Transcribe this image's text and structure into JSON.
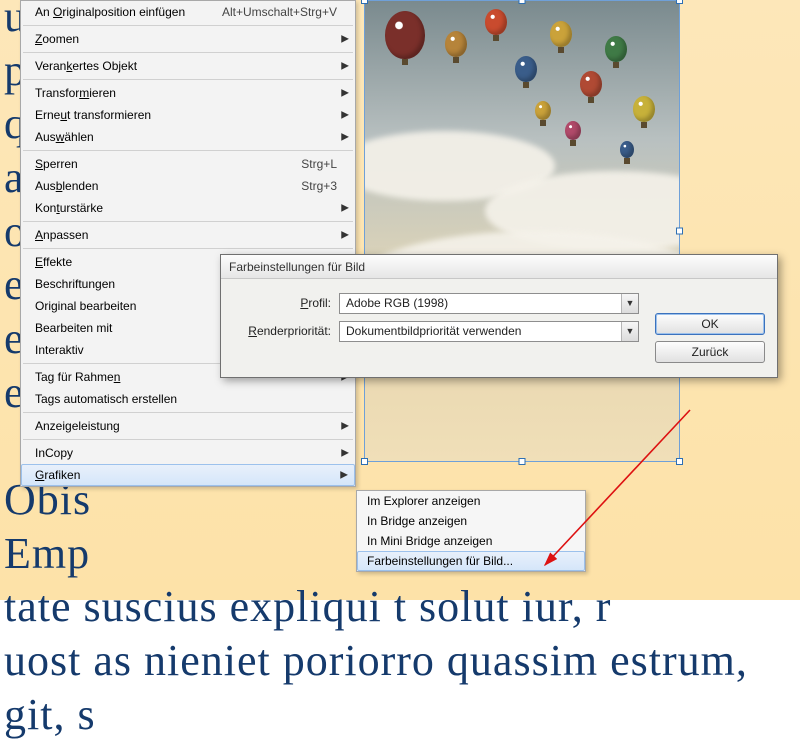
{
  "background_text": "                                                ut e\n                                               pore\n                                              quos\n                                              am, i\n                                              od q\n                                                  e\n                                                  e\n                                                 ep\n\n                                              Obis\n                                              Emp\ntate suscius expliqui t                 solut   iur, r\nuost as nieniet poriorro quassim estrum,  git, s",
  "menu": {
    "items": [
      {
        "label_pre": "An ",
        "u": "O",
        "label_post": "riginalposition einfügen",
        "shortcut": "Alt+Umschalt+Strg+V",
        "arrow": false
      },
      {
        "sep": true
      },
      {
        "label_pre": "",
        "u": "Z",
        "label_post": "oomen",
        "shortcut": "",
        "arrow": true
      },
      {
        "sep": true
      },
      {
        "label_pre": "Veran",
        "u": "k",
        "label_post": "ertes Objekt",
        "shortcut": "",
        "arrow": true
      },
      {
        "sep": true
      },
      {
        "label_pre": "Transfor",
        "u": "m",
        "label_post": "ieren",
        "shortcut": "",
        "arrow": true
      },
      {
        "label_pre": "Erne",
        "u": "u",
        "label_post": "t transformieren",
        "shortcut": "",
        "arrow": true
      },
      {
        "label_pre": "Aus",
        "u": "w",
        "label_post": "ählen",
        "shortcut": "",
        "arrow": true
      },
      {
        "sep": true
      },
      {
        "label_pre": "",
        "u": "S",
        "label_post": "perren",
        "shortcut": "Strg+L",
        "arrow": false
      },
      {
        "label_pre": "Aus",
        "u": "b",
        "label_post": "lenden",
        "shortcut": "Strg+3",
        "arrow": false
      },
      {
        "label_pre": "Kon",
        "u": "t",
        "label_post": "urstärke",
        "shortcut": "",
        "arrow": true
      },
      {
        "sep": true
      },
      {
        "label_pre": "",
        "u": "A",
        "label_post": "npassen",
        "shortcut": "",
        "arrow": true
      },
      {
        "sep": true
      },
      {
        "label_pre": "",
        "u": "E",
        "label_post": "ffekte",
        "shortcut": "",
        "arrow": true
      },
      {
        "label_pre": "",
        "u": "",
        "label_post": "Beschriftungen",
        "shortcut": "",
        "arrow": true
      },
      {
        "label_pre": "",
        "u": "",
        "label_post": "Original bearbeiten",
        "shortcut": "",
        "arrow": false
      },
      {
        "label_pre": "",
        "u": "",
        "label_post": "Bearbeiten mit",
        "shortcut": "",
        "arrow": true
      },
      {
        "label_pre": "",
        "u": "",
        "label_post": "Interaktiv",
        "shortcut": "",
        "arrow": true
      },
      {
        "sep": true
      },
      {
        "label_pre": "Tag für Rahme",
        "u": "n",
        "label_post": "",
        "shortcut": "",
        "arrow": true
      },
      {
        "label_pre": "",
        "u": "",
        "label_post": "Tags automatisch erstellen",
        "shortcut": "",
        "arrow": false
      },
      {
        "sep": true
      },
      {
        "label_pre": "",
        "u": "",
        "label_post": "Anzeigeleistung",
        "shortcut": "",
        "arrow": true
      },
      {
        "sep": true
      },
      {
        "label_pre": "",
        "u": "",
        "label_post": "InCopy",
        "shortcut": "",
        "arrow": true
      },
      {
        "label_pre": "",
        "u": "G",
        "label_post": "rafiken",
        "shortcut": "",
        "arrow": true,
        "hover": true
      }
    ]
  },
  "submenu": {
    "items": [
      {
        "label": "Im Explorer anzeigen"
      },
      {
        "label": "In Bridge anzeigen"
      },
      {
        "label": "In Mini Bridge anzeigen"
      },
      {
        "label": "Farbeinstellungen für Bild...",
        "hover": true
      }
    ]
  },
  "dialog": {
    "title": "Farbeinstellungen für Bild",
    "profile_label_pre": "",
    "profile_u": "P",
    "profile_label_post": "rofil:",
    "profile_value": "Adobe RGB (1998)",
    "render_label_pre": "",
    "render_u": "R",
    "render_label_post": "enderpriorität:",
    "render_value": "Dokumentbildpriorität verwenden",
    "ok": "OK",
    "cancel": "Zurück"
  }
}
